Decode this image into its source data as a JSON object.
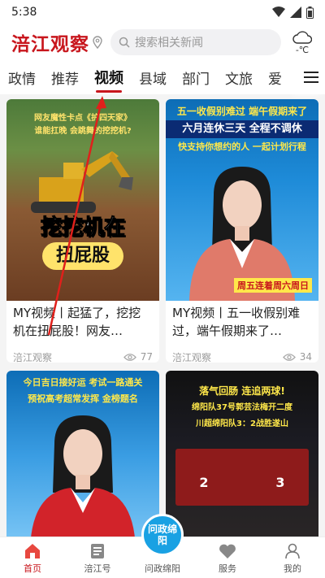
{
  "status_bar": {
    "time": "5:38"
  },
  "header": {
    "logo": "涪江观察",
    "search_placeholder": "搜索相关新闻",
    "weather_temp": "-℃"
  },
  "tabs": [
    {
      "label": "政情"
    },
    {
      "label": "推荐"
    },
    {
      "label": "视频",
      "active": true
    },
    {
      "label": "县域"
    },
    {
      "label": "部门"
    },
    {
      "label": "文旅"
    },
    {
      "label": "爱"
    }
  ],
  "cards": [
    {
      "thumb_lines": [
        "网友魔性卡点《护四天家》",
        "谁能扛晚 会跳舞的挖挖机?"
      ],
      "thumb_big": [
        "挖挖机在",
        "扭屁股"
      ],
      "title": "MY视频丨起猛了，挖挖机在扭屁股！网友…",
      "source": "涪江观察",
      "views": "77"
    },
    {
      "thumb_lines": [
        "五一收假别难过 端午假期来了",
        "六月连休三天 全程不调休",
        "快支持你想约的人 一起计划行程"
      ],
      "thumb_tag": "周五连着周六周日",
      "title": "MY视频丨五一收假别难过，端午假期来了…",
      "source": "涪江观察",
      "views": "34"
    },
    {
      "thumb_lines": [
        "今日吉日接好运 考试一路通关",
        "预祝高考超常发挥 金榜题名"
      ]
    },
    {
      "thumb_lines": [
        "落气回肠 连追两球!",
        "绵阳队37号郭芸法梅开二度",
        "川超绵阳队3：2战胜遂山"
      ],
      "scores": [
        "2",
        "3"
      ]
    }
  ],
  "bottom_nav": [
    {
      "label": "首页",
      "icon": "home-icon",
      "active": true
    },
    {
      "label": "涪江号",
      "icon": "list-icon"
    },
    {
      "label": "问政绵阳",
      "icon": "center-logo",
      "center_text": "问政绵阳"
    },
    {
      "label": "服务",
      "icon": "heart-icon"
    },
    {
      "label": "我的",
      "icon": "user-icon"
    }
  ],
  "colors": {
    "brand": "#c8161d",
    "accent_blue": "#19a1e3"
  }
}
